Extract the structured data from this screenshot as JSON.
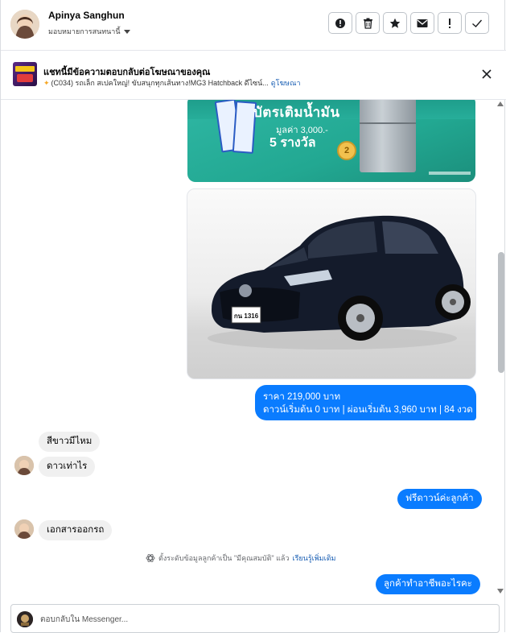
{
  "header": {
    "contact_name": "Apinya Sanghun",
    "assign_label": "มอบหมายการสนทนานี้",
    "action_icons": [
      "alert-circle-icon",
      "trash-icon",
      "star-icon",
      "mail-icon",
      "exclamation-icon",
      "check-icon"
    ]
  },
  "ad_banner": {
    "title": "แชทนี้มีข้อความตอบกลับต่อโฆษณาของคุณ",
    "subtitle": "(C034) รถเล็ก สเปคใหญ่! ขับสนุกทุกเส้นทาง!MG3 Hatchback ดีไซน์...",
    "link": "ดูโฆษณา"
  },
  "promo_image": {
    "title": "บัตรเติมน้ำมัน",
    "value_text": "มูลค่า 3,000.-",
    "prize_text": "5 รางวัล",
    "medal_number": "2"
  },
  "car_image": {
    "plate_text": "กน 1316"
  },
  "messages": {
    "price_line1": "ราคา 219,000 บาท",
    "price_line2": "ดาวน์เริ่มต้น 0 บาท | ผ่อนเริ่มต้น 3,960 บาท | 84 งวด",
    "incoming_color": "สีขาวมีไหม",
    "incoming_down": "ดาวเท่าไร",
    "outgoing_free": "ฟรีดาวน์ค่ะลูกค้า",
    "incoming_doc": "เอกสารออกรถ",
    "outgoing_job": "ลูกค้าทำอาชีพอะไรคะ"
  },
  "system_notice": {
    "text": "ตั้งระดับข้อมูลลูกค้าเป็น \"มีคุณสมบัติ\" แล้ว",
    "link": "เรียนรู้เพิ่มเติม"
  },
  "composer": {
    "placeholder": "ตอบกลับใน Messenger..."
  },
  "colors": {
    "accent": "#0a7cff",
    "link": "#1a5fb4",
    "incoming_bubble": "#f0f0f0"
  }
}
